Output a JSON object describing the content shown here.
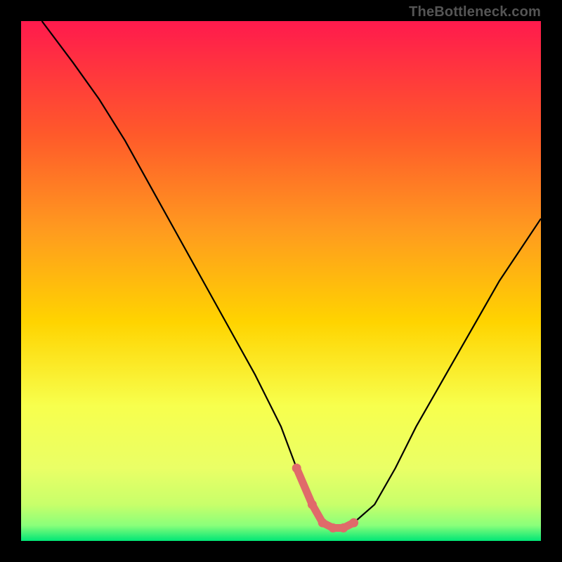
{
  "watermark": "TheBottleneck.com",
  "chart_data": {
    "type": "line",
    "title": "",
    "xlabel": "",
    "ylabel": "",
    "xlim": [
      0,
      100
    ],
    "ylim": [
      0,
      100
    ],
    "grid": false,
    "legend": false,
    "series": [
      {
        "name": "curve",
        "x": [
          4,
          10,
          15,
          20,
          25,
          30,
          35,
          40,
          45,
          50,
          53,
          56,
          58,
          60,
          62,
          64,
          68,
          72,
          76,
          80,
          84,
          88,
          92,
          96,
          100
        ],
        "y": [
          100,
          92,
          85,
          77,
          68,
          59,
          50,
          41,
          32,
          22,
          14,
          7,
          3.5,
          2.5,
          2.5,
          3.5,
          7,
          14,
          22,
          29,
          36,
          43,
          50,
          56,
          62
        ]
      },
      {
        "name": "trough-highlight",
        "x": [
          53,
          56,
          58,
          60,
          62,
          64
        ],
        "y": [
          14,
          7,
          3.5,
          2.5,
          2.5,
          3.5
        ]
      }
    ],
    "background_gradient": {
      "top": "#ff1a4d",
      "mid_upper": "#ff8a1f",
      "mid": "#ffd400",
      "mid_lower": "#f7ff4d",
      "lower": "#d8ff5a",
      "bottom": "#00e676"
    },
    "colors": {
      "curve": "#000000",
      "highlight": "#e06a6a",
      "frame": "#000000"
    }
  }
}
